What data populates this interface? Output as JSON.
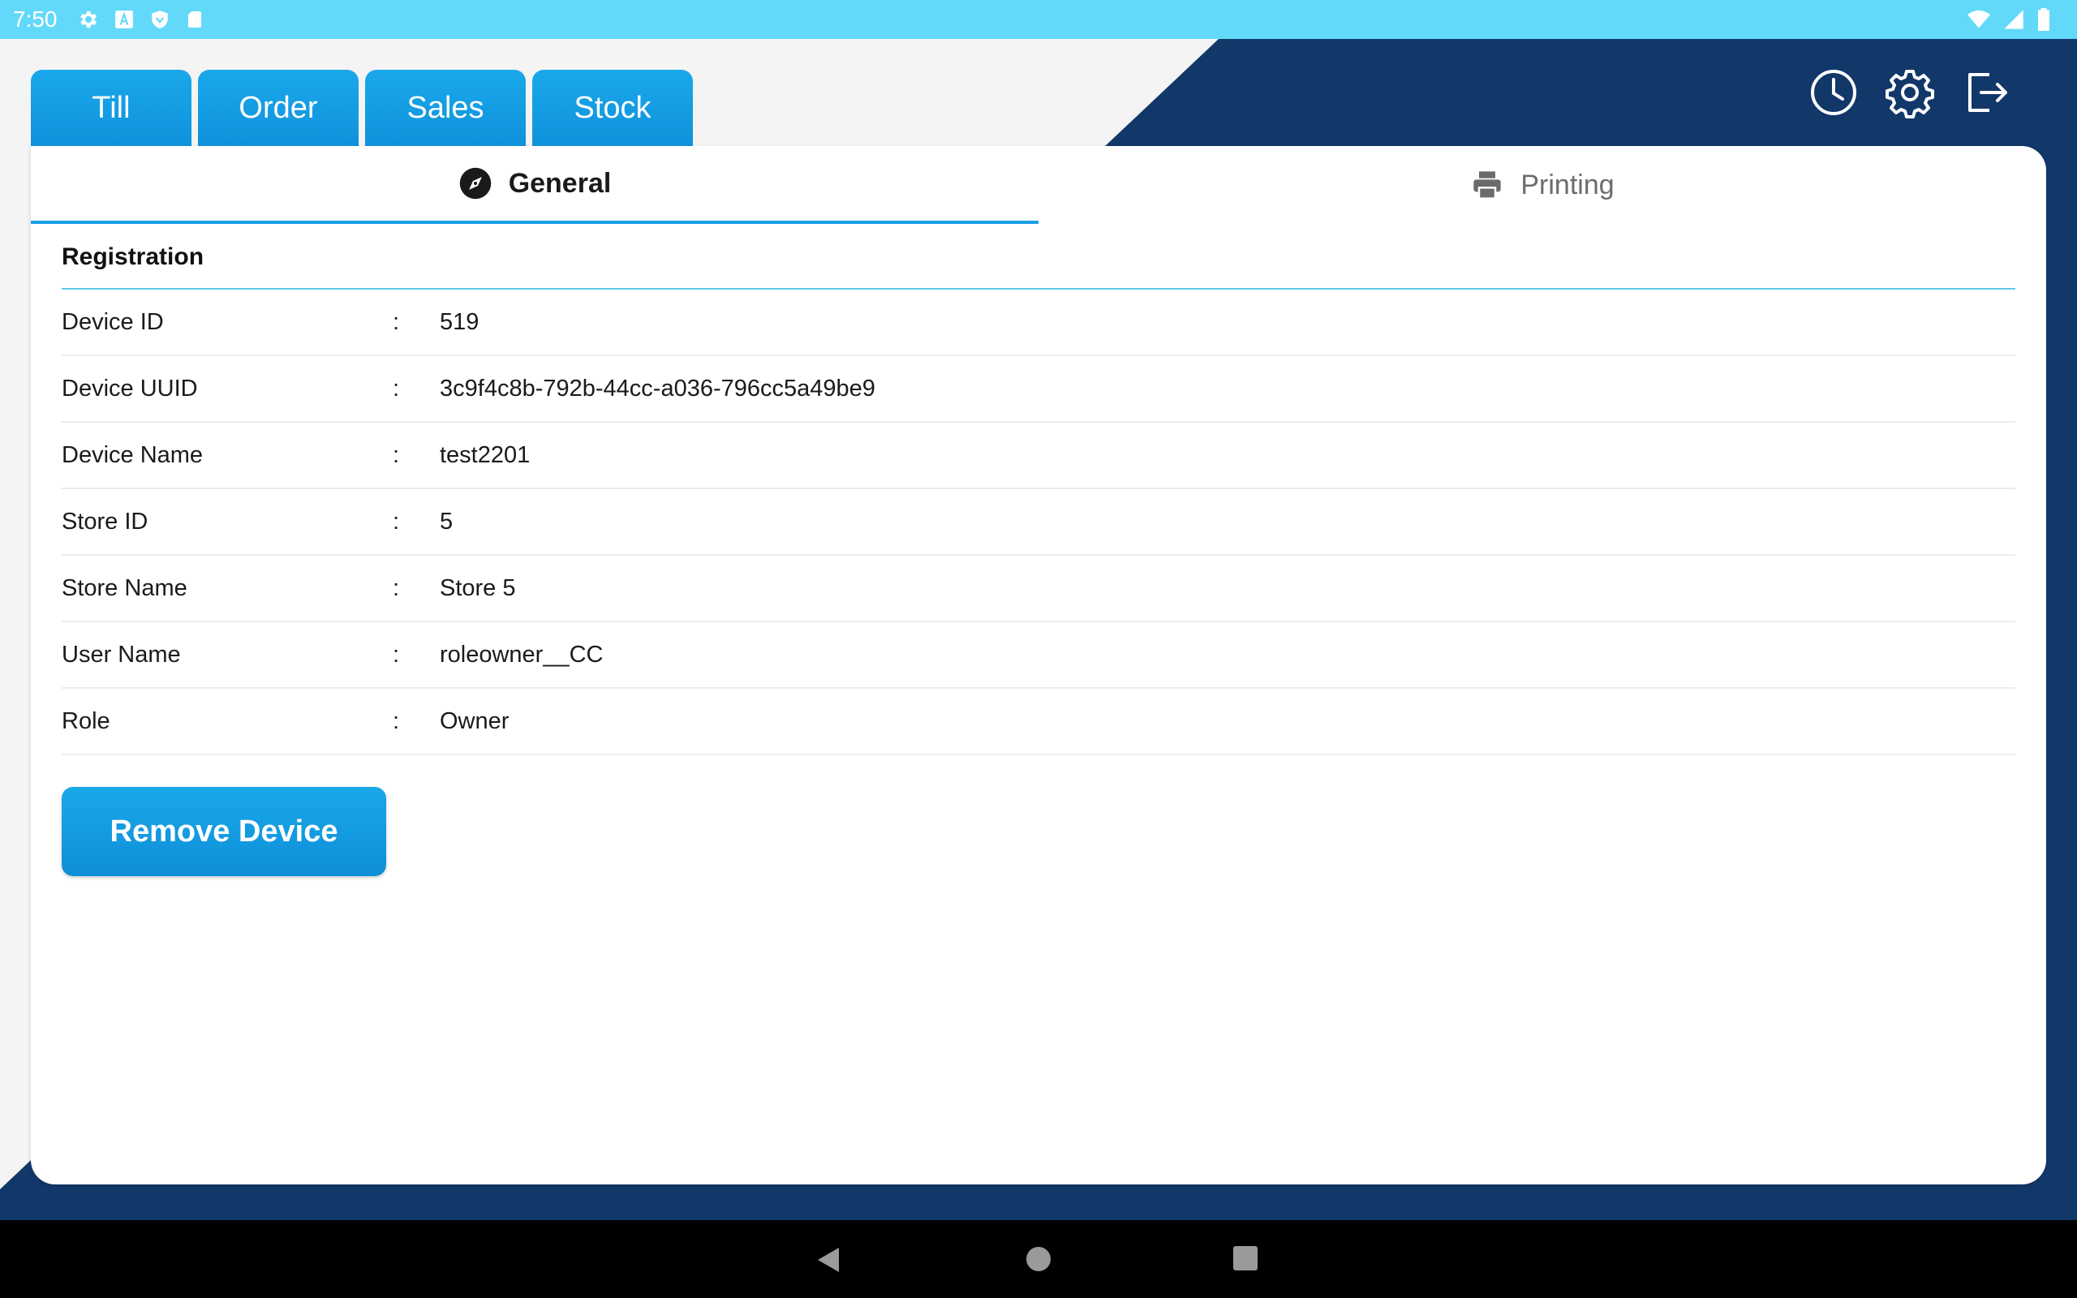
{
  "status_bar": {
    "time": "7:50",
    "icons": [
      "gear-icon",
      "a-icon",
      "shield-icon",
      "sd-card-icon"
    ],
    "right_icons": [
      "wifi-icon",
      "signal-icon",
      "battery-icon"
    ]
  },
  "top_tabs": [
    {
      "label": "Till"
    },
    {
      "label": "Order"
    },
    {
      "label": "Sales"
    },
    {
      "label": "Stock"
    }
  ],
  "header_icons": [
    "clock-icon",
    "settings-icon",
    "logout-icon"
  ],
  "subtabs": {
    "general": "General",
    "printing": "Printing"
  },
  "section": {
    "title": "Registration"
  },
  "rows": [
    {
      "label": "Device ID",
      "value": "519"
    },
    {
      "label": "Device UUID",
      "value": "3c9f4c8b-792b-44cc-a036-796cc5a49be9"
    },
    {
      "label": "Device Name",
      "value": "test2201"
    },
    {
      "label": "Store ID",
      "value": "5"
    },
    {
      "label": "Store Name",
      "value": "Store 5"
    },
    {
      "label": "User Name",
      "value": "roleowner__CC"
    },
    {
      "label": "Role",
      "value": "Owner"
    }
  ],
  "colon": ":",
  "remove_button": "Remove Device",
  "nav": [
    "back-icon",
    "home-icon",
    "recents-icon"
  ],
  "colors": {
    "accent": "#1aa0e6",
    "header_dark": "#12386a",
    "status_bar": "#63d9fa"
  }
}
